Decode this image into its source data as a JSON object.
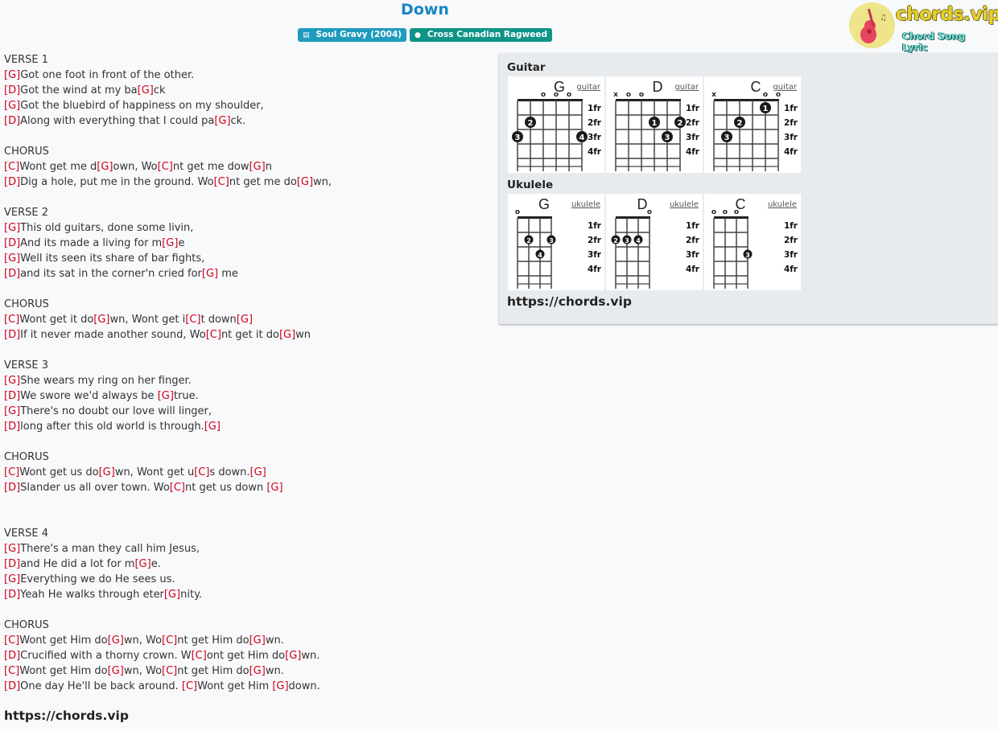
{
  "song": {
    "title": "Down",
    "album_badge": "Soul Gravy (2004)",
    "artist_badge": "Cross Canadian Ragweed",
    "album_icon": "book-icon",
    "artist_icon": "user-icon"
  },
  "logo": {
    "text": "chords.vip",
    "subtext": "Chord Song Lyric",
    "icon": "guitar-icon"
  },
  "lyrics": [
    {
      "section": "VERSE 1",
      "lines": [
        [
          [
            "G",
            ""
          ],
          [
            "",
            "Got one foot in front of the other."
          ]
        ],
        [
          [
            "D",
            ""
          ],
          [
            "",
            "Got the wind at my ba"
          ],
          [
            "G",
            ""
          ],
          [
            "",
            "ck"
          ]
        ],
        [
          [
            "G",
            ""
          ],
          [
            "",
            "Got the bluebird of happiness on my shoulder,"
          ]
        ],
        [
          [
            "D",
            ""
          ],
          [
            "",
            "Along with everything that I could pa"
          ],
          [
            "G",
            ""
          ],
          [
            "",
            "ck."
          ]
        ]
      ]
    },
    {
      "section": "CHORUS",
      "lines": [
        [
          [
            "C",
            ""
          ],
          [
            "",
            "Wont get me d"
          ],
          [
            "G",
            ""
          ],
          [
            "",
            "own, Wo"
          ],
          [
            "C",
            ""
          ],
          [
            "",
            "nt get me dow"
          ],
          [
            "G",
            ""
          ],
          [
            "",
            "n"
          ]
        ],
        [
          [
            "D",
            ""
          ],
          [
            "",
            "Dig a hole, put me in the ground. Wo"
          ],
          [
            "C",
            ""
          ],
          [
            "",
            "nt get me do"
          ],
          [
            "G",
            ""
          ],
          [
            "",
            "wn,"
          ]
        ]
      ]
    },
    {
      "section": "VERSE 2",
      "lines": [
        [
          [
            "G",
            ""
          ],
          [
            "",
            "This old guitars, done some livin,"
          ]
        ],
        [
          [
            "D",
            ""
          ],
          [
            "",
            "And its made a living for m"
          ],
          [
            "G",
            ""
          ],
          [
            "",
            "e"
          ]
        ],
        [
          [
            "G",
            ""
          ],
          [
            "",
            "Well its seen its share of bar fights,"
          ]
        ],
        [
          [
            "D",
            ""
          ],
          [
            "",
            "and its sat in the corner'n cried for"
          ],
          [
            "G",
            ""
          ],
          [
            "",
            " me"
          ]
        ]
      ]
    },
    {
      "section": "CHORUS",
      "lines": [
        [
          [
            "C",
            ""
          ],
          [
            "",
            "Wont get it do"
          ],
          [
            "G",
            ""
          ],
          [
            "",
            "wn, Wont get i"
          ],
          [
            "C",
            ""
          ],
          [
            "",
            "t down"
          ],
          [
            "G",
            ""
          ]
        ],
        [
          [
            "D",
            ""
          ],
          [
            "",
            "If it never made another sound, Wo"
          ],
          [
            "C",
            ""
          ],
          [
            "",
            "nt get it do"
          ],
          [
            "G",
            ""
          ],
          [
            "",
            "wn"
          ]
        ]
      ]
    },
    {
      "section": "VERSE 3",
      "lines": [
        [
          [
            "G",
            ""
          ],
          [
            "",
            "She wears my ring on her finger."
          ]
        ],
        [
          [
            "D",
            ""
          ],
          [
            "",
            "We swore we'd always be "
          ],
          [
            "G",
            ""
          ],
          [
            "",
            "true."
          ]
        ],
        [
          [
            "G",
            ""
          ],
          [
            "",
            "There's no doubt our love will linger,"
          ]
        ],
        [
          [
            "D",
            ""
          ],
          [
            "",
            "long after this old world is through."
          ],
          [
            "G",
            ""
          ]
        ]
      ]
    },
    {
      "section": "CHORUS",
      "lines": [
        [
          [
            "C",
            ""
          ],
          [
            "",
            "Wont get us do"
          ],
          [
            "G",
            ""
          ],
          [
            "",
            "wn, Wont get u"
          ],
          [
            "C",
            ""
          ],
          [
            "",
            "s down."
          ],
          [
            "G",
            ""
          ]
        ],
        [
          [
            "D",
            ""
          ],
          [
            "",
            "Slander us all over town. Wo"
          ],
          [
            "C",
            ""
          ],
          [
            "",
            "nt get us down "
          ],
          [
            "G",
            ""
          ]
        ]
      ],
      "extra_blank": true
    },
    {
      "section": "VERSE 4",
      "lines": [
        [
          [
            "G",
            ""
          ],
          [
            "",
            "There's a man they call him Jesus,"
          ]
        ],
        [
          [
            "D",
            ""
          ],
          [
            "",
            "and He did a lot for m"
          ],
          [
            "G",
            ""
          ],
          [
            "",
            "e."
          ]
        ],
        [
          [
            "G",
            ""
          ],
          [
            "",
            "Everything we do He sees us."
          ]
        ],
        [
          [
            "D",
            ""
          ],
          [
            "",
            "Yeah He walks through eter"
          ],
          [
            "G",
            ""
          ],
          [
            "",
            "nity."
          ]
        ]
      ]
    },
    {
      "section": "CHORUS",
      "lines": [
        [
          [
            "C",
            ""
          ],
          [
            "",
            "Wont get Him do"
          ],
          [
            "G",
            ""
          ],
          [
            "",
            "wn, Wo"
          ],
          [
            "C",
            ""
          ],
          [
            "",
            "nt get Him do"
          ],
          [
            "G",
            ""
          ],
          [
            "",
            "wn."
          ]
        ],
        [
          [
            "D",
            ""
          ],
          [
            "",
            "Crucified with a thorny crown. W"
          ],
          [
            "C",
            ""
          ],
          [
            "",
            "ont get Him do"
          ],
          [
            "G",
            ""
          ],
          [
            "",
            "wn."
          ]
        ],
        [
          [
            "C",
            ""
          ],
          [
            "",
            "Wont get Him do"
          ],
          [
            "G",
            ""
          ],
          [
            "",
            "wn, Wo"
          ],
          [
            "C",
            ""
          ],
          [
            "",
            "nt get Him do"
          ],
          [
            "G",
            ""
          ],
          [
            "",
            "wn."
          ]
        ],
        [
          [
            "D",
            ""
          ],
          [
            "",
            "One day He'll be back around. "
          ],
          [
            "C",
            ""
          ],
          [
            "",
            "Wont get Him "
          ],
          [
            "G",
            ""
          ],
          [
            "",
            "down."
          ]
        ]
      ]
    }
  ],
  "lyrics_footer_url": "https://chords.vip",
  "chord_panel": {
    "guitar_heading": "Guitar",
    "ukulele_heading": "Ukulele",
    "url": "https://chords.vip",
    "fret_labels": [
      "1fr",
      "2fr",
      "3fr",
      "4fr"
    ],
    "guitar": [
      {
        "name": "G",
        "link": "guitar",
        "strings": [
          "",
          "",
          "o",
          "o",
          "o",
          ""
        ],
        "dots": [
          {
            "string": 1,
            "fret": 2,
            "finger": "2"
          },
          {
            "string": 0,
            "fret": 3,
            "finger": "3"
          },
          {
            "string": 5,
            "fret": 3,
            "finger": "4"
          }
        ]
      },
      {
        "name": "D",
        "link": "guitar",
        "strings": [
          "x",
          "o",
          "o",
          "",
          "",
          ""
        ],
        "dots": [
          {
            "string": 3,
            "fret": 2,
            "finger": "1"
          },
          {
            "string": 5,
            "fret": 2,
            "finger": "2"
          },
          {
            "string": 4,
            "fret": 3,
            "finger": "3"
          }
        ]
      },
      {
        "name": "C",
        "link": "guitar",
        "strings": [
          "x",
          "",
          "",
          "",
          "o",
          "o"
        ],
        "dots": [
          {
            "string": 4,
            "fret": 1,
            "finger": "1"
          },
          {
            "string": 2,
            "fret": 2,
            "finger": "2"
          },
          {
            "string": 1,
            "fret": 3,
            "finger": "3"
          }
        ]
      }
    ],
    "ukulele": [
      {
        "name": "G",
        "link": "ukulele",
        "strings": [
          "o",
          "",
          "",
          ""
        ],
        "dots": [
          {
            "string": 1,
            "fret": 2,
            "finger": "2"
          },
          {
            "string": 3,
            "fret": 2,
            "finger": "3"
          },
          {
            "string": 2,
            "fret": 3,
            "finger": "4"
          }
        ]
      },
      {
        "name": "D",
        "link": "ukulele",
        "strings": [
          "",
          "",
          "",
          "o"
        ],
        "dots": [
          {
            "string": 0,
            "fret": 2,
            "finger": "2"
          },
          {
            "string": 1,
            "fret": 2,
            "finger": "3"
          },
          {
            "string": 2,
            "fret": 2,
            "finger": "4"
          }
        ]
      },
      {
        "name": "C",
        "link": "ukulele",
        "strings": [
          "o",
          "o",
          "o",
          ""
        ],
        "dots": [
          {
            "string": 3,
            "fret": 3,
            "finger": "3"
          }
        ]
      }
    ]
  }
}
